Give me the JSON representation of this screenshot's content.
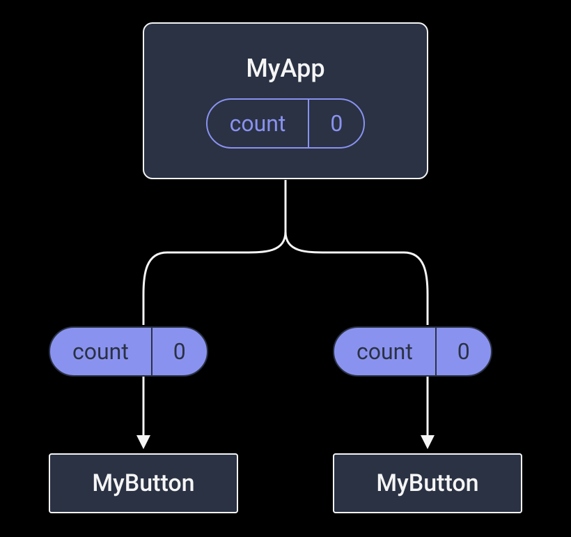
{
  "parent": {
    "title": "MyApp",
    "state": {
      "label": "count",
      "value": "0"
    }
  },
  "props": {
    "left": {
      "label": "count",
      "value": "0"
    },
    "right": {
      "label": "count",
      "value": "0"
    }
  },
  "children": {
    "left": "MyButton",
    "right": "MyButton"
  },
  "colors": {
    "accent": "#8a92f0",
    "box": "#2a3244",
    "stroke": "#f5f5f5"
  }
}
